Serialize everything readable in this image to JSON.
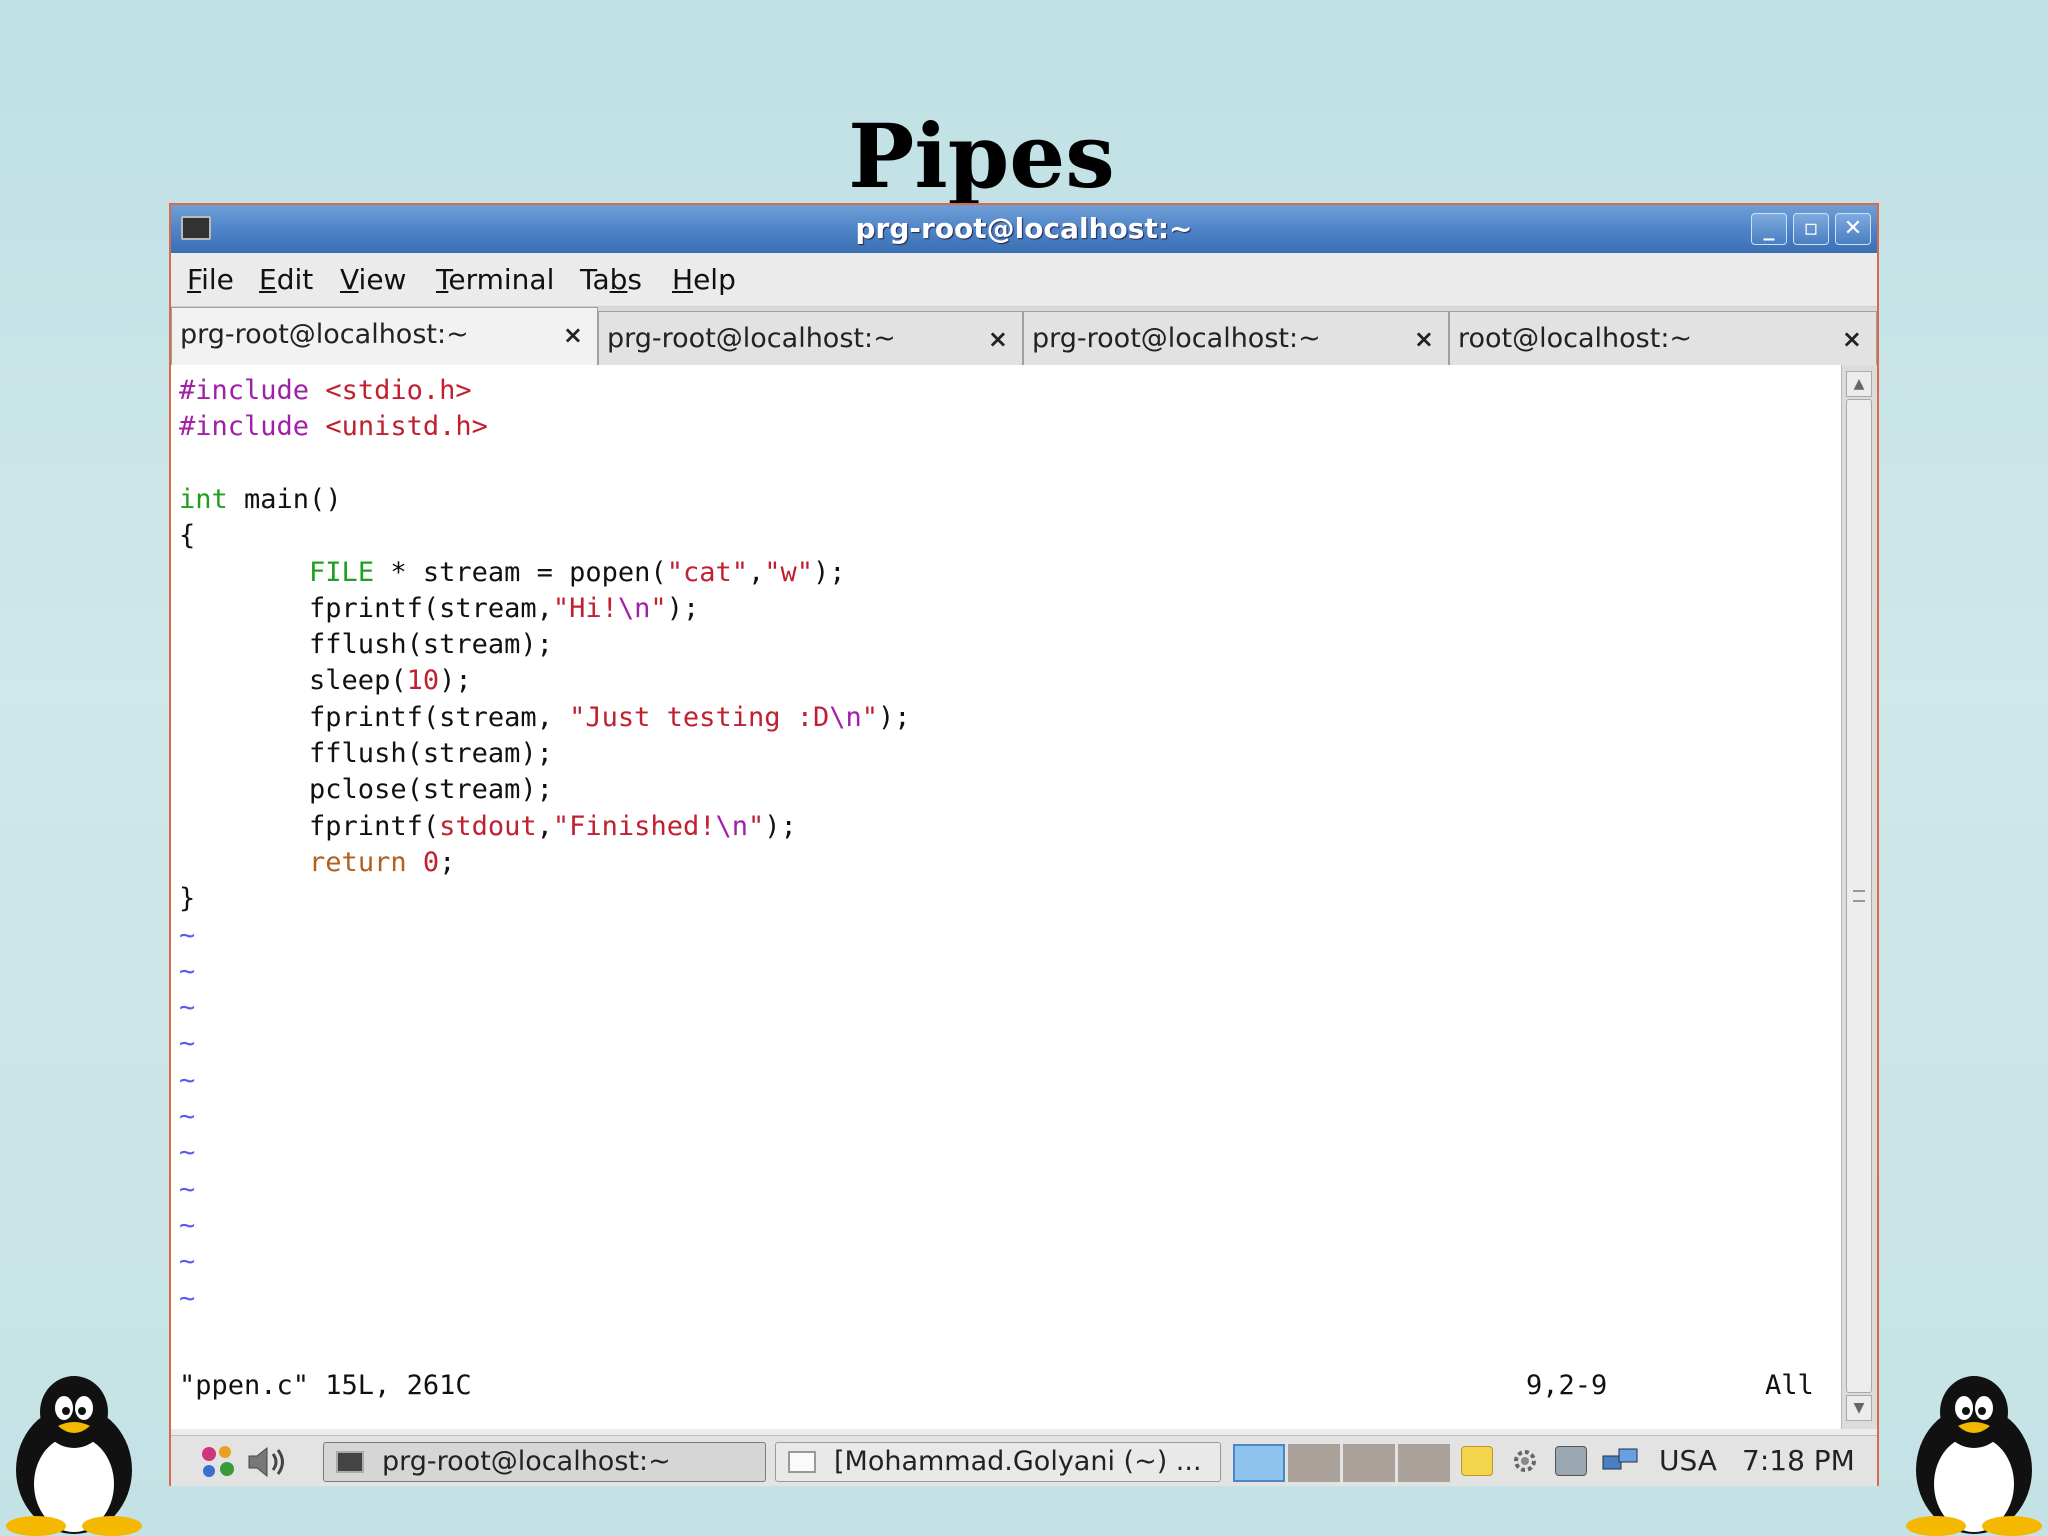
{
  "slide": {
    "title": "Pipes"
  },
  "window": {
    "title": "prg-root@localhost:~",
    "controls": {
      "minimize": "_",
      "maximize": "▫",
      "close": "✕"
    }
  },
  "menu": [
    {
      "mnemonic": "F",
      "rest": "ile"
    },
    {
      "mnemonic": "E",
      "rest": "dit"
    },
    {
      "mnemonic": "V",
      "rest": "iew"
    },
    {
      "mnemonic": "T",
      "rest": "erminal"
    },
    {
      "prefix": "Ta",
      "mnemonic": "b",
      "rest": "s"
    },
    {
      "mnemonic": "H",
      "rest": "elp"
    }
  ],
  "tabs": [
    {
      "label": "prg-root@localhost:~",
      "close": "×",
      "active": true
    },
    {
      "label": "prg-root@localhost:~",
      "close": "×",
      "active": false
    },
    {
      "label": "prg-root@localhost:~",
      "close": "×",
      "active": false
    },
    {
      "label": "root@localhost:~",
      "close": "×",
      "active": false
    }
  ],
  "code": [
    [
      [
        "pre",
        "#include "
      ],
      [
        "inc",
        "<stdio.h>"
      ]
    ],
    [
      [
        "pre",
        "#include "
      ],
      [
        "inc",
        "<unistd.h>"
      ]
    ],
    [],
    [
      [
        "type",
        "int"
      ],
      [
        "",
        " main()"
      ]
    ],
    [
      [
        "",
        "{"
      ]
    ],
    [
      [
        "",
        "        "
      ],
      [
        "type",
        "FILE"
      ],
      [
        "",
        " * stream = popen("
      ],
      [
        "str",
        "\"cat\""
      ],
      [
        "",
        ","
      ],
      [
        "str",
        "\"w\""
      ],
      [
        "",
        ");"
      ]
    ],
    [
      [
        "",
        "        fprintf(stream,"
      ],
      [
        "str",
        "\"Hi!"
      ],
      [
        "esc",
        "\\n"
      ],
      [
        "str",
        "\""
      ],
      [
        "",
        ");"
      ]
    ],
    [
      [
        "",
        "        fflush(stream);"
      ]
    ],
    [
      [
        "",
        "        sleep("
      ],
      [
        "num",
        "10"
      ],
      [
        "",
        ");"
      ]
    ],
    [
      [
        "",
        "        fprintf(stream, "
      ],
      [
        "str",
        "\"Just testing :D"
      ],
      [
        "esc",
        "\\n"
      ],
      [
        "str",
        "\""
      ],
      [
        "",
        ");"
      ]
    ],
    [
      [
        "",
        "        fflush(stream);"
      ]
    ],
    [
      [
        "",
        "        pclose(stream);"
      ]
    ],
    [
      [
        "",
        "        fprintf("
      ],
      [
        "str",
        "stdout"
      ],
      [
        "",
        ","
      ],
      [
        "str",
        "\"Finished!"
      ],
      [
        "esc",
        "\\n"
      ],
      [
        "str",
        "\""
      ],
      [
        "",
        ");"
      ]
    ],
    [
      [
        "",
        "        "
      ],
      [
        "kw",
        "return"
      ],
      [
        "",
        " "
      ],
      [
        "num",
        "0"
      ],
      [
        "",
        ";"
      ]
    ],
    [
      [
        "",
        "}"
      ]
    ]
  ],
  "tilde": "~",
  "tilde_count": 11,
  "status": {
    "file": "\"ppen.c\" 15L, 261C",
    "position": "9,2-9",
    "scroll": "All"
  },
  "taskbar": {
    "tasks": [
      {
        "label": "prg-root@localhost:~",
        "icon": "terminal-icon",
        "active": true
      },
      {
        "label": "[Mohammad.Golyani (~) ...",
        "icon": "text-editor-icon",
        "active": false
      }
    ],
    "keyboard": "USA",
    "clock": "7:18 PM"
  },
  "colors": {
    "titlebar": "#4c82c6",
    "window_border": "#d86a4a",
    "preprocessor": "#a020a8",
    "string": "#c02030",
    "type": "#20a020",
    "keyword": "#b06020",
    "tilde": "#5a5af0"
  }
}
